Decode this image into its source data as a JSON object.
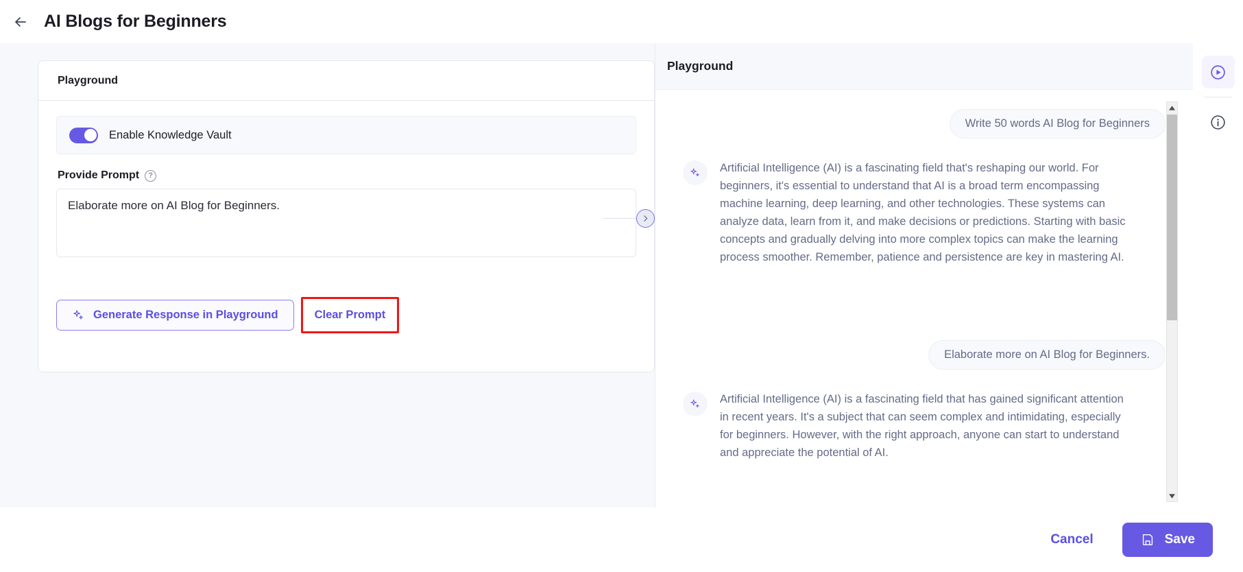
{
  "header": {
    "back_icon": "arrow-left-icon",
    "title": "AI Blogs for Beginners"
  },
  "left_panel": {
    "card_title": "Playground",
    "toggle": {
      "label": "Enable Knowledge Vault",
      "state": "on",
      "accent_color": "#6759e3"
    },
    "prompt_field": {
      "label": "Provide Prompt",
      "help_icon": "question-circle-icon",
      "value": "Elaborate more on AI Blog for Beginners.",
      "placeholder": "Provide Prompt"
    },
    "buttons": {
      "generate_label": "Generate Response in Playground",
      "generate_icon": "sparkle-icon",
      "clear_label": "Clear Prompt",
      "clear_highlight_color": "#f51414"
    }
  },
  "collapse_button": {
    "icon": "chevron-right-icon"
  },
  "playground": {
    "title": "Playground",
    "messages": [
      {
        "role": "user",
        "text": "Write 50 words AI Blog for Beginners"
      },
      {
        "role": "assistant",
        "icon": "sparkle-icon",
        "text": "Artificial Intelligence (AI) is a fascinating field that's reshaping our world. For beginners, it's essential to understand that AI is a broad term encompassing machine learning, deep learning, and other technologies. These systems can analyze data, learn from it, and make decisions or predictions. Starting with basic concepts and gradually delving into more complex topics can make the learning process smoother. Remember, patience and persistence are key in mastering AI."
      },
      {
        "role": "user",
        "text": "Elaborate more on AI Blog for Beginners."
      },
      {
        "role": "assistant",
        "icon": "sparkle-icon",
        "text": "Artificial Intelligence (AI) is a fascinating field that has gained significant attention in recent years. It's a subject that can seem complex and intimidating, especially for beginners. However, with the right approach, anyone can start to understand and appreciate the potential of AI."
      }
    ]
  },
  "rail": {
    "items": [
      {
        "icon": "play-circle-icon",
        "active": true
      },
      {
        "icon": "info-circle-icon",
        "active": false
      }
    ]
  },
  "footer": {
    "cancel_label": "Cancel",
    "save_label": "Save",
    "save_icon": "save-disk-icon",
    "save_color": "#6759e3"
  }
}
